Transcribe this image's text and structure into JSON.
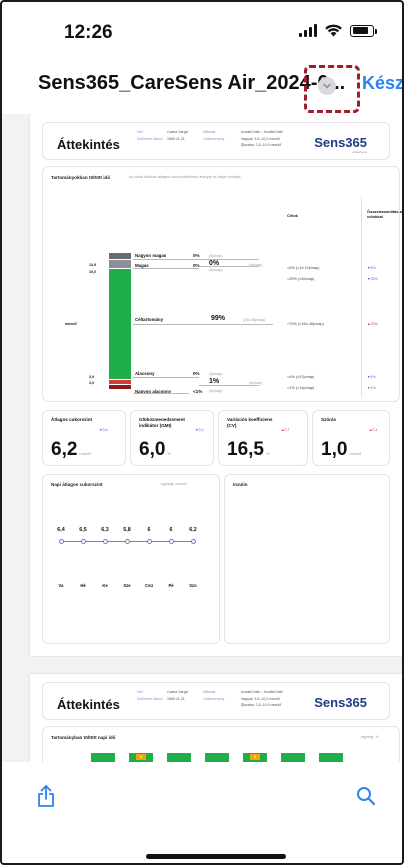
{
  "status": {
    "time": "12:26"
  },
  "nav": {
    "title": "Sens365_CareSens Air_2024-0...",
    "done": "Kész"
  },
  "report": {
    "header": {
      "title": "Áttekintés",
      "brand": "Sens365",
      "brand_sub": "+CareSens",
      "meta": [
        {
          "label": "Név",
          "value": "Csaba Varga"
        },
        {
          "label": "Születési dátum",
          "value": "1960.11.21."
        },
        {
          "label": "Időszak",
          "value": "Invalid Date – Invalid Date"
        },
        {
          "label": "Céltartomány",
          "value": "Nappal: 3,9–10,0 mmol/l"
        },
        {
          "label": "",
          "value": "Éjszaka: 3,9–10,0 mmol/l"
        }
      ]
    },
    "tir": {
      "title": "Tartományokban töltött idő",
      "subtitle": "Az adott időszak átlagos cukorértékeinek arányát és idejét mutatja.",
      "col_goals": "Célok",
      "col_compare": "Összehasonlítás a célokkal",
      "unit": "mmol/l",
      "scale": [
        "13,9",
        "10,0",
        "3,9",
        "3,0"
      ],
      "rows": [
        {
          "name": "Nagyon magas",
          "pct": "0%",
          "time": "(0p/nap)",
          "goal": "<5% (<1d 12p/nap)",
          "cmp": "▼5%"
        },
        {
          "name": "Magas",
          "pct": "0%",
          "time": "(0p/nap)",
          "goal": "<25% (<6ó/nap)",
          "cmp": "▼25%"
        },
        {
          "name": "Céltartomány",
          "pct": "99%",
          "time": "(23ó 46p/nap)",
          "goal": ">70% (>16ó 48p/nap)",
          "cmp": "▲29%"
        },
        {
          "name": "Alacsony",
          "pct": "0%",
          "time": "(0p/nap)",
          "goal": "<4% (<57p/nap)",
          "cmp": "▼4%"
        },
        {
          "name": "Nagyon alacsony",
          "pct": "<1%",
          "time": "(0p/nap)",
          "goal": "<1% (<14p/nap)",
          "cmp": "▼1%"
        }
      ],
      "group_high": {
        "pct": "0%",
        "time": "(0p/nap)"
      },
      "group_low": {
        "pct": "1%",
        "time": "(0p/nap)"
      }
    },
    "stats": [
      {
        "title": "Átlagos cukorszint",
        "value": "6,2",
        "unit": "mmol/l",
        "delta": "▼0,6",
        "dir": "down"
      },
      {
        "title": "Glükózmenedzsment indikátor (GMI)",
        "value": "6,0",
        "unit": "%",
        "delta": "▼0,2",
        "dir": "down"
      },
      {
        "title": "Variációs koefficiens (CV)",
        "value": "16,5",
        "unit": "%",
        "delta": "▲0,7",
        "dir": "up"
      },
      {
        "title": "Szórás",
        "value": "1,0",
        "unit": "mmol/l",
        "delta": "▲0,1",
        "dir": "up"
      }
    ],
    "daily": {
      "title": "Napi átlagos cukorszint",
      "unit_label": "egység: mmol/l",
      "values": [
        "6,4",
        "6,5",
        "6,3",
        "5,8",
        "6",
        "6",
        "6,2"
      ],
      "days": [
        "Va",
        "Hé",
        "Ke",
        "Sze",
        "Csü",
        "Pé",
        "Szo"
      ]
    },
    "insulin": {
      "title": "Inzulin"
    }
  },
  "page2": {
    "title": "Áttekintés",
    "brand": "Sens365",
    "section": "Tartományban töltött napi idő",
    "unit_label": "egység: %",
    "badge": "1"
  },
  "colors": {
    "accent": "#2a84f2",
    "target": "#1fae4a",
    "low": "#d23c3c",
    "high": "#6b6b74"
  }
}
